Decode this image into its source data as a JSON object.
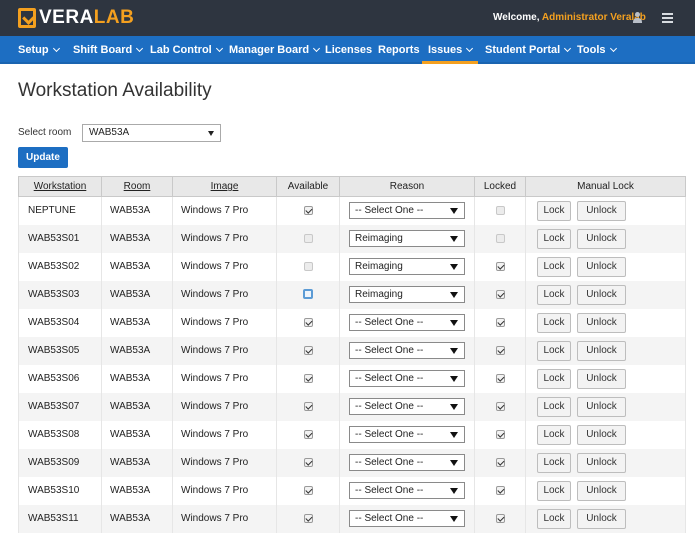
{
  "app": {
    "logo_left": "VERA",
    "logo_right": "LAB",
    "welcome_prefix": "Welcome, ",
    "welcome_user": "Administrator Veralab"
  },
  "nav": [
    {
      "label": "Setup",
      "dropdown": true
    },
    {
      "label": "Shift Board",
      "dropdown": true
    },
    {
      "label": "Lab Control",
      "dropdown": true
    },
    {
      "label": "Manager Board",
      "dropdown": true
    },
    {
      "label": "Licenses",
      "dropdown": false
    },
    {
      "label": "Reports",
      "dropdown": false
    },
    {
      "label": "Issues",
      "dropdown": true,
      "active": true
    },
    {
      "label": "Student Portal",
      "dropdown": true
    },
    {
      "label": "Tools",
      "dropdown": true
    }
  ],
  "page": {
    "title": "Workstation Availability",
    "room_label": "Select room",
    "room_value": "WAB53A",
    "update_label": "Update"
  },
  "table": {
    "headers": [
      "Workstation",
      "Room",
      "Image",
      "Available",
      "Reason",
      "Locked",
      "Manual Lock"
    ],
    "lock_label": "Lock",
    "unlock_label": "Unlock",
    "rows": [
      {
        "ws": "NEPTUNE",
        "room": "WAB53A",
        "image": "Windows 7 Pro",
        "available": "on",
        "reason": "-- Select One --",
        "locked": "off"
      },
      {
        "ws": "WAB53S01",
        "room": "WAB53A",
        "image": "Windows 7 Pro",
        "available": "off",
        "reason": "Reimaging",
        "locked": "off"
      },
      {
        "ws": "WAB53S02",
        "room": "WAB53A",
        "image": "Windows 7 Pro",
        "available": "off",
        "reason": "Reimaging",
        "locked": "on"
      },
      {
        "ws": "WAB53S03",
        "room": "WAB53A",
        "image": "Windows 7 Pro",
        "available": "focus",
        "reason": "Reimaging",
        "locked": "on"
      },
      {
        "ws": "WAB53S04",
        "room": "WAB53A",
        "image": "Windows 7 Pro",
        "available": "on",
        "reason": "-- Select One --",
        "locked": "on"
      },
      {
        "ws": "WAB53S05",
        "room": "WAB53A",
        "image": "Windows 7 Pro",
        "available": "on",
        "reason": "-- Select One --",
        "locked": "on"
      },
      {
        "ws": "WAB53S06",
        "room": "WAB53A",
        "image": "Windows 7 Pro",
        "available": "on",
        "reason": "-- Select One --",
        "locked": "on"
      },
      {
        "ws": "WAB53S07",
        "room": "WAB53A",
        "image": "Windows 7 Pro",
        "available": "on",
        "reason": "-- Select One --",
        "locked": "on"
      },
      {
        "ws": "WAB53S08",
        "room": "WAB53A",
        "image": "Windows 7 Pro",
        "available": "on",
        "reason": "-- Select One --",
        "locked": "on"
      },
      {
        "ws": "WAB53S09",
        "room": "WAB53A",
        "image": "Windows 7 Pro",
        "available": "on",
        "reason": "-- Select One --",
        "locked": "on"
      },
      {
        "ws": "WAB53S10",
        "room": "WAB53A",
        "image": "Windows 7 Pro",
        "available": "on",
        "reason": "-- Select One --",
        "locked": "on"
      },
      {
        "ws": "WAB53S11",
        "room": "WAB53A",
        "image": "Windows 7 Pro",
        "available": "on",
        "reason": "-- Select One --",
        "locked": "on"
      }
    ]
  },
  "icons": {
    "user": "user-icon",
    "menu": "hamburger-menu-icon",
    "caret": "chevron-down-icon"
  },
  "colors": {
    "topbar": "#2e3540",
    "nav": "#1d6ec2",
    "accent": "#f4a01f"
  }
}
